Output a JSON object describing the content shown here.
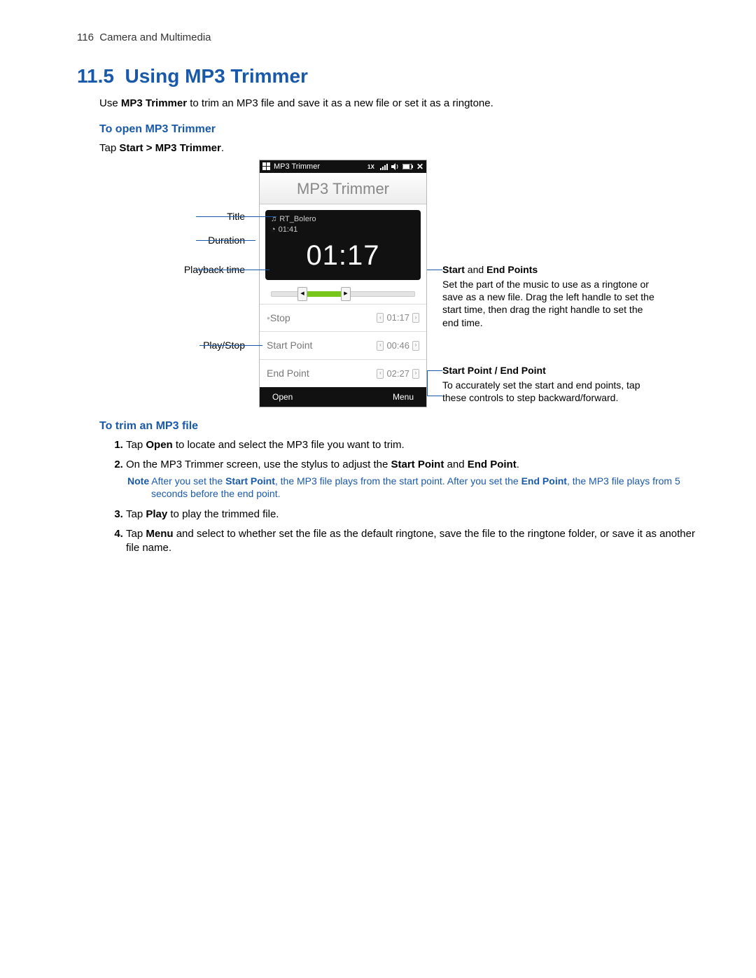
{
  "header": {
    "page_num": "116",
    "chapter": "Camera and Multimedia"
  },
  "section": {
    "number": "11.5",
    "title": "Using MP3 Trimmer",
    "intro_pre": "Use ",
    "intro_app": "MP3 Trimmer",
    "intro_post": " to trim an MP3 file and save it as a new file or set it as a ringtone."
  },
  "open": {
    "heading": "To open MP3 Trimmer",
    "tap": "Tap ",
    "path": "Start > MP3 Trimmer",
    "dot": "."
  },
  "screen": {
    "status_app": "MP3 Trimmer",
    "title": "MP3 Trimmer",
    "song": "RT_Bolero",
    "duration": "01:41",
    "big_time": "01:17",
    "stop_label": "Stop",
    "stop_val": "01:17",
    "sp_label": "Start Point",
    "sp_val": "00:46",
    "ep_label": "End Point",
    "ep_val": "02:27",
    "open": "Open",
    "menu": "Menu"
  },
  "left_labels": {
    "title": "Title",
    "duration": "Duration",
    "playback": "Playback time",
    "playstop": "Play/Stop"
  },
  "right_callout1": {
    "head": "Start",
    "mid": " and ",
    "head2": "End Points",
    "body": "Set the part of the music to use as a ringtone or save as a new file. Drag the left handle to set the start time, then drag the right handle to set the end time."
  },
  "right_callout2": {
    "head": "Start Point / End Point",
    "body": "To accurately set the start and end points, tap these controls to step backward/forward."
  },
  "trim": {
    "heading": "To trim an MP3 file",
    "s1_pre": "Tap ",
    "s1_b": "Open",
    "s1_post": " to locate and select the MP3 file you want to trim.",
    "s2_pre": "On the MP3 Trimmer screen, use the stylus to adjust the ",
    "s2_b1": "Start Point",
    "s2_mid": " and ",
    "s2_b2": "End Point",
    "s2_dot": ".",
    "note_pre": "Note",
    "note_sp": "  After you set the ",
    "note_b1": "Start Point",
    "note_mid": ", the MP3 file plays from the start point. After you set the ",
    "note_b2": "End Point",
    "note_post": ", the MP3 file plays from 5 seconds before the end point.",
    "s3_pre": "Tap ",
    "s3_b": "Play",
    "s3_post": " to play the trimmed file.",
    "s4_pre": "Tap ",
    "s4_b": "Menu",
    "s4_post": " and select to whether set the file as the default ringtone, save the file to the ringtone folder, or save it as another file name."
  }
}
